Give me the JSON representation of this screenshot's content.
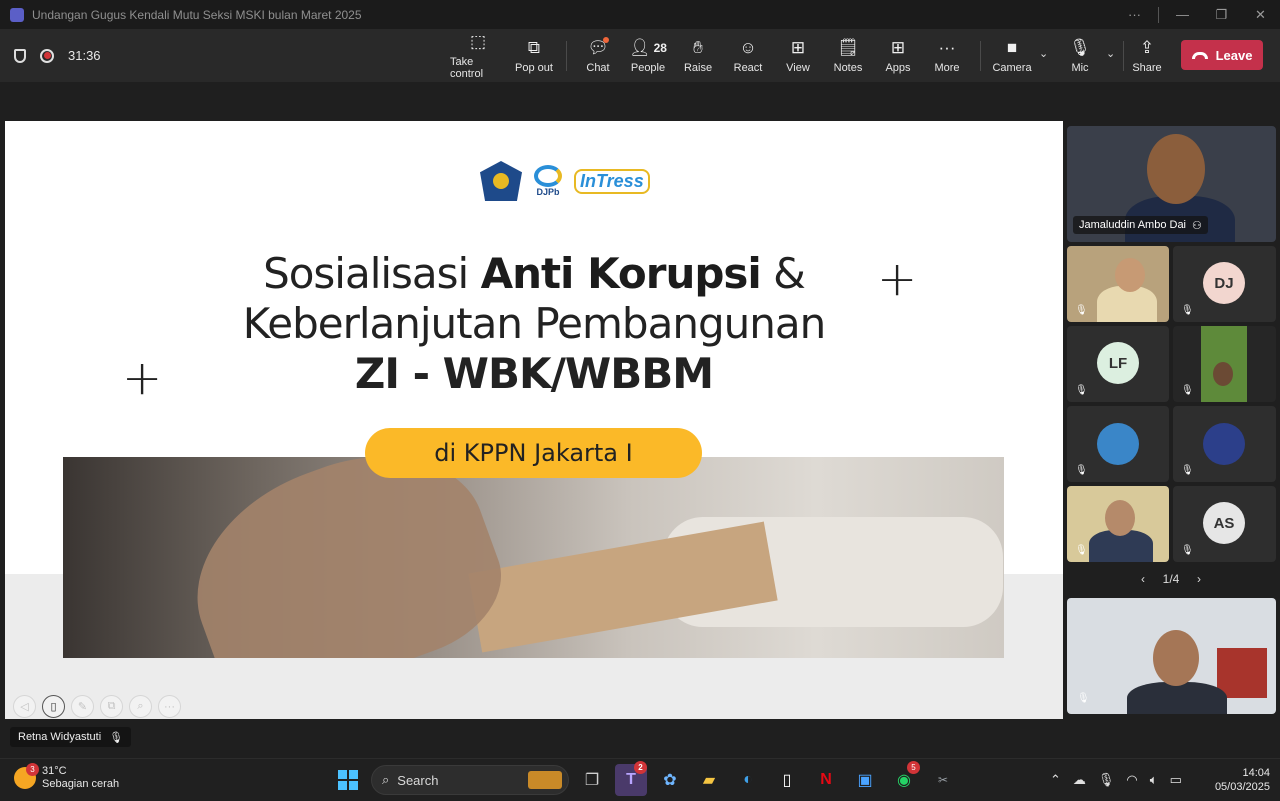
{
  "window": {
    "title": "Undangan Gugus Kendali Mutu Seksi MSKI bulan Maret 2025"
  },
  "meeting": {
    "timer": "31:36"
  },
  "toolbar": {
    "take_control": "Take control",
    "pop_out": "Pop out",
    "chat": "Chat",
    "people": "People",
    "people_count": "28",
    "raise": "Raise",
    "react": "React",
    "view": "View",
    "notes": "Notes",
    "apps": "Apps",
    "more": "More",
    "camera": "Camera",
    "mic": "Mic",
    "share": "Share",
    "leave": "Leave",
    "leave_color": "#c4314b"
  },
  "slide": {
    "logo_text_djpb": "DJPb",
    "logo_text_intress": "InTress",
    "line1_normal": "Sosialisasi ",
    "line1_bold": "Anti Korupsi",
    "line1_end": " &",
    "line2": "Keberlanjutan Pembangunan",
    "line3": "ZI - WBK/WBBM",
    "pill": "di KPPN Jakarta I",
    "pill_color": "#fbb928"
  },
  "presenter": {
    "name": "Retna Widyastuti"
  },
  "participants": {
    "main_name": "Jamaluddin Ambo Dai",
    "initials": [
      "DJ",
      "LF",
      "AS"
    ],
    "pager": "1/4"
  },
  "taskbar": {
    "weather_temp": "31°C",
    "weather_desc": "Sebagian cerah",
    "weather_badge": "3",
    "search_label": "Search",
    "teams_badge": "2",
    "whatsapp_badge": "5",
    "time": "14:04",
    "date": "05/03/2025"
  }
}
